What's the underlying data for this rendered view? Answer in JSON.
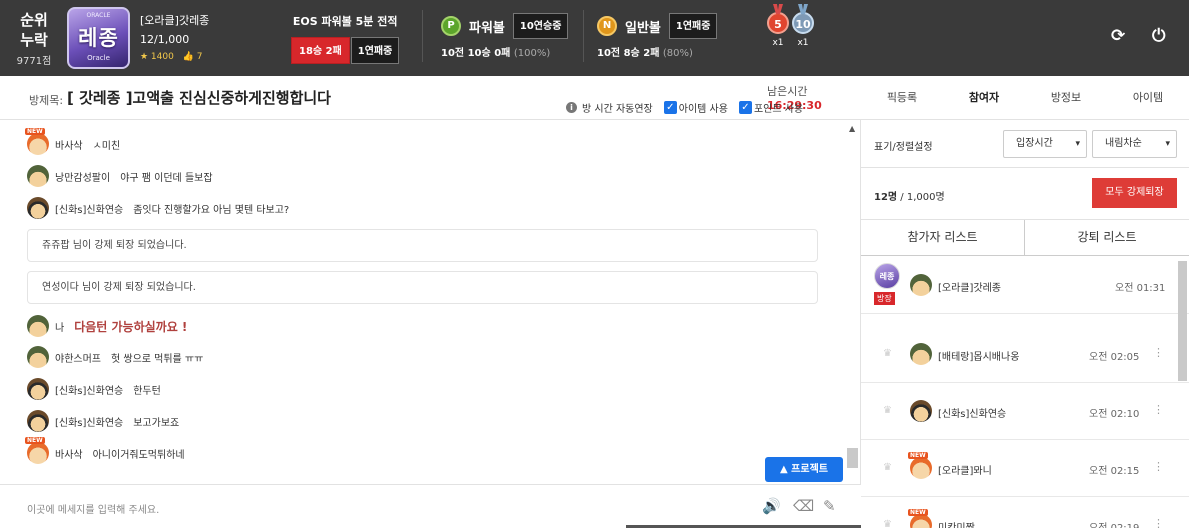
{
  "topbar": {
    "rank_line1": "순위",
    "rank_line2": "누락",
    "rank_points": "9771점",
    "avatar_text": "레종",
    "avatar_sub": "Oracle",
    "avatar_top": "ORACLE",
    "username": "[오라클]갓레종",
    "member_count": "12/1,000",
    "stars": "★ 1400",
    "likes": "👍 7",
    "eos_title": "EOS 파워볼 5분 전적",
    "eos_record": "18승 2패",
    "eos_streak": "1연패중",
    "powerball": {
      "icon": "P",
      "label": "파워볼",
      "tag": "10연승중",
      "result": "10전 10승 0패",
      "pct": "(100%)"
    },
    "normalball": {
      "icon": "N",
      "label": "일반볼",
      "tag": "1연패중",
      "result": "10전 8승 2패",
      "pct": "(80%)"
    },
    "medal1": {
      "num": "5",
      "count": "x1"
    },
    "medal2": {
      "num": "10",
      "count": "x1"
    },
    "refresh_icon": "refresh-icon",
    "power_icon": "power-icon"
  },
  "room": {
    "title_label": "방제목:",
    "title": "[ 갓레종 ]고액출 진심신중하게진행합니다",
    "remain_label": "남은시간",
    "remain_time": "16:29:30",
    "opt_autoextend": "방 시간 자동연장",
    "opt_items": "아이템 사용",
    "opt_points": "포인트 사용"
  },
  "rtabs": [
    "픽등록",
    "참여자",
    "방정보",
    "아이템"
  ],
  "chat": {
    "messages": [
      {
        "face": "new",
        "nick": "바사삭",
        "text": "ㅅ미친"
      },
      {
        "face": "army",
        "nick": "낭만감성팔이",
        "text": "야구 팸 이던데 들보잡"
      },
      {
        "face": "sung",
        "nick": "[신화s]신화연승",
        "text": "좀잇다 진행할가요 아님 몇텐 타보고?"
      },
      {
        "face": "army",
        "nick": "나",
        "text": "다음턴 가능하실까요 !"
      },
      {
        "face": "army",
        "nick": "야한스머프",
        "text": "헛 쌍으로 먹튀를 ㅠㅠ"
      },
      {
        "face": "sung",
        "nick": "[신화s]신화연승",
        "text": "한두턴"
      },
      {
        "face": "sung",
        "nick": "[신화s]신화연승",
        "text": "보고가보죠"
      },
      {
        "face": "new",
        "nick": "바사삭",
        "text": "아니이거줘도먹튀하네"
      }
    ],
    "notices": [
      "쥬쥬팝 님이 강제 퇴장 되었습니다.",
      "연성이다 님이 강제 퇴장 되었습니다."
    ],
    "protect_label": "▲ 프로젝트",
    "input_placeholder": "이곳에 메세지를 입력해 주세요."
  },
  "panel": {
    "sort_label": "표기/정렬설정",
    "sort_field": "입장시간",
    "sort_order": "내림차순",
    "count_current": "12명",
    "count_total": " / 1,000명",
    "kick_all": "모두 강제퇴장",
    "tab_participants": "참가자 리스트",
    "tab_kicked": "강퇴 리스트",
    "host_badge": "방장",
    "participants": [
      {
        "name": "[오라클]갓레종",
        "time": "오전 01:31",
        "host": true
      },
      {
        "name": "[배테랑]몹시배나옹",
        "time": "오전 02:05",
        "host": false
      },
      {
        "name": "[신화s]신화연승",
        "time": "오전 02:10",
        "host": false
      },
      {
        "name": "[오라클]뫄니",
        "time": "오전 02:15",
        "host": false
      },
      {
        "name": "미칸미짱",
        "time": "오전 02:19",
        "host": false
      }
    ]
  }
}
